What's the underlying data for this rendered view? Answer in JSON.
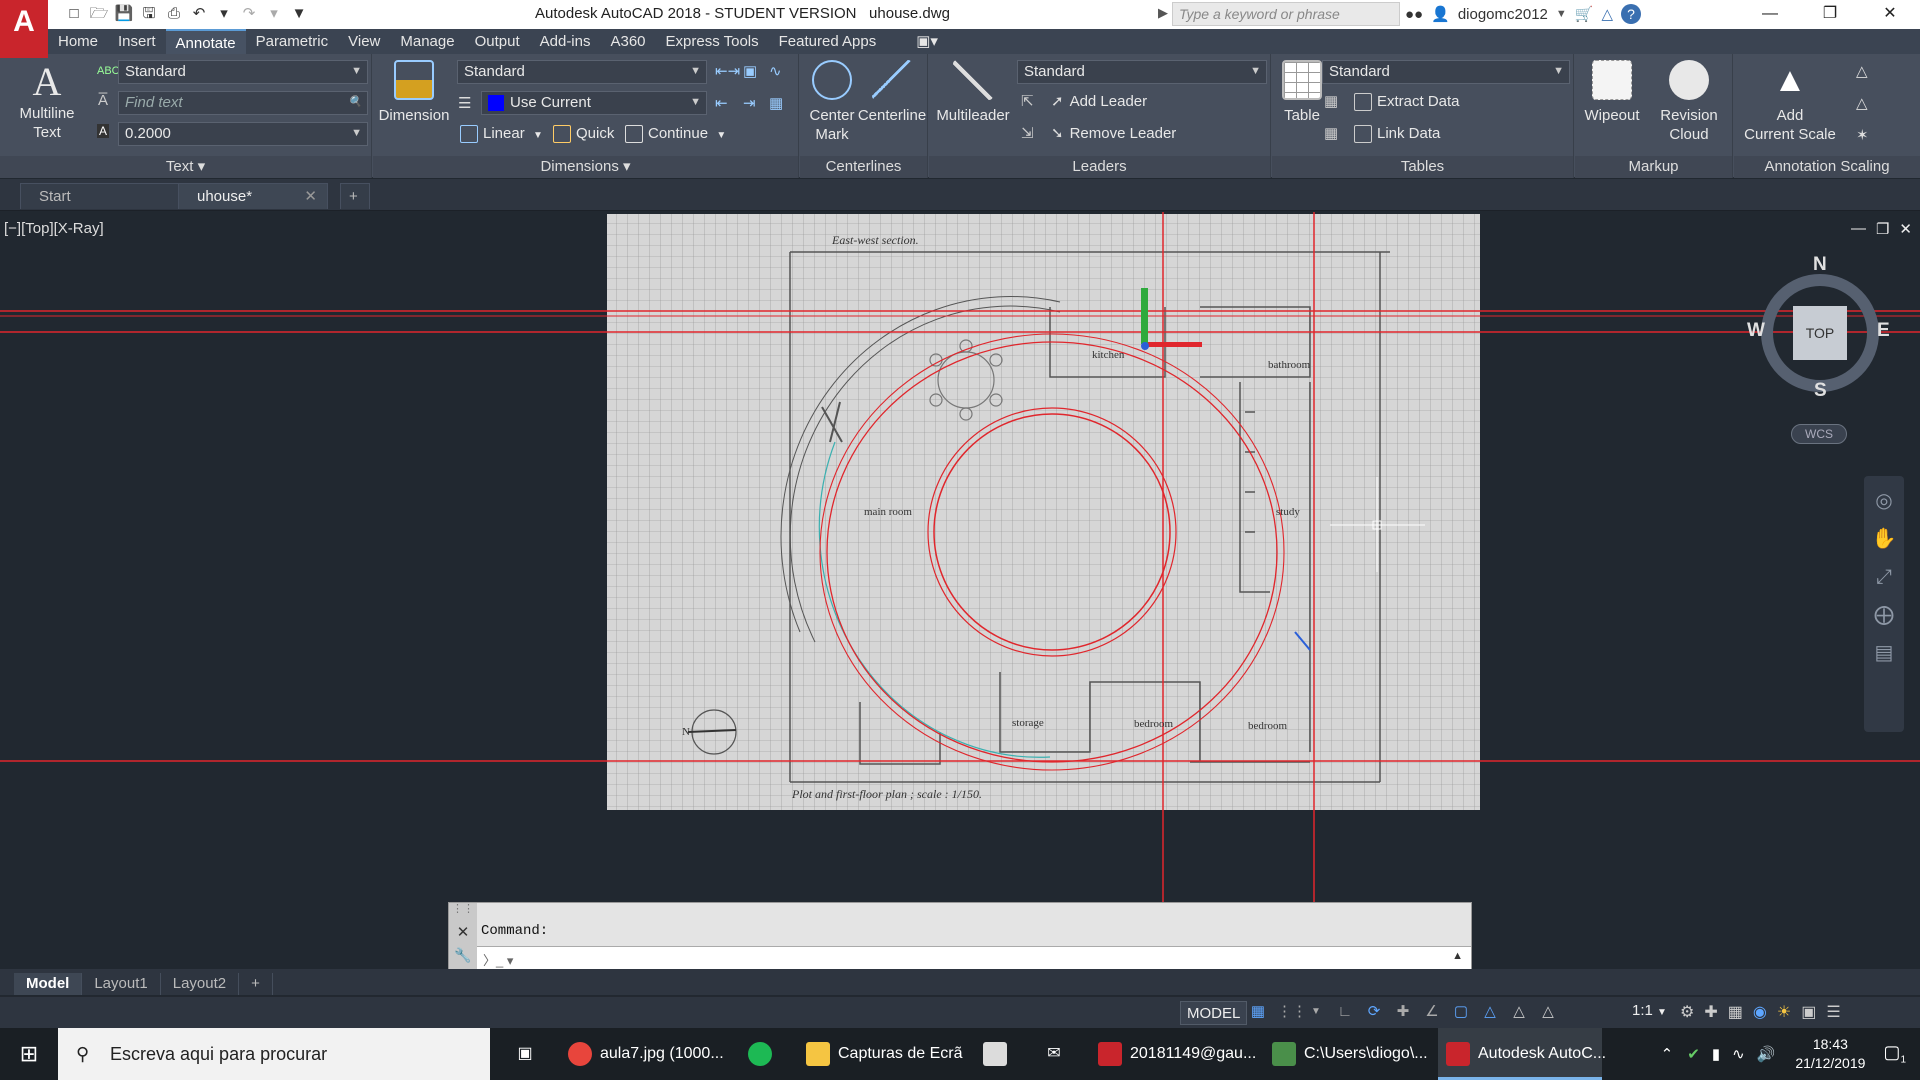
{
  "app": {
    "logo": "A",
    "title": "Autodesk AutoCAD 2018 - STUDENT VERSION",
    "filename": "uhouse.dwg",
    "search_placeholder": "Type a keyword or phrase",
    "user": "diogomc2012"
  },
  "menu_tabs": [
    "Home",
    "Insert",
    "Annotate",
    "Parametric",
    "View",
    "Manage",
    "Output",
    "Add-ins",
    "A360",
    "Express Tools",
    "Featured Apps"
  ],
  "ribbon": {
    "text": {
      "multiline_label_1": "Multiline",
      "multiline_label_2": "Text",
      "style": "Standard",
      "find_placeholder": "Find text",
      "height": "0.2000",
      "title": "Text"
    },
    "dimensions": {
      "button": "Dimension",
      "style": "Standard",
      "layer": "Use Current",
      "linear": "Linear",
      "quick": "Quick",
      "continue": "Continue",
      "title": "Dimensions"
    },
    "centerlines": {
      "center_mark_1": "Center",
      "center_mark_2": "Mark",
      "centerline": "Centerline",
      "title": "Centerlines"
    },
    "leaders": {
      "button": "Multileader",
      "style": "Standard",
      "add": "Add Leader",
      "remove": "Remove Leader",
      "title": "Leaders"
    },
    "tables": {
      "button": "Table",
      "style": "Standard",
      "extract": "Extract Data",
      "link": "Link Data",
      "title": "Tables"
    },
    "markup": {
      "wipeout": "Wipeout",
      "revision_1": "Revision",
      "revision_2": "Cloud",
      "title": "Markup"
    },
    "annotation_scaling": {
      "add_1": "Add",
      "add_2": "Current Scale",
      "title": "Annotation Scaling"
    }
  },
  "doc_tabs": [
    {
      "label": "Start",
      "active": false
    },
    {
      "label": "uhouse*",
      "active": true
    }
  ],
  "viewport": {
    "label": "[−][Top][X-Ray]",
    "compass": {
      "n": "N",
      "s": "S",
      "e": "E",
      "w": "W",
      "face": "TOP"
    },
    "wcs": "WCS",
    "drawing_labels": {
      "section": "East-west section.",
      "kitchen": "kitchen",
      "bathroom": "bathroom",
      "main_room": "main room",
      "study": "study",
      "storage": "storage",
      "bedroom_1": "bedroom",
      "bedroom_2": "bedroom",
      "north": "N",
      "caption": "Plot and first-floor plan ; scale : 1/150."
    }
  },
  "command": {
    "prompt": "Command:"
  },
  "layout_tabs": [
    {
      "label": "Model",
      "active": true
    },
    {
      "label": "Layout1",
      "active": false
    },
    {
      "label": "Layout2",
      "active": false
    }
  ],
  "statusbar": {
    "model": "MODEL",
    "scale": "1:1"
  },
  "taskbar": {
    "search": "Escreva aqui para procurar",
    "apps": [
      {
        "label": "aula7.jpg (1000...",
        "color": "#e8453c"
      },
      {
        "label": "Capturas de Ecrã",
        "color": "#f5c542"
      },
      {
        "label": "20181149@gau...",
        "color": "#c9252c"
      },
      {
        "label": "C:\\Users\\diogo\\...",
        "color": "#4a8f4a"
      },
      {
        "label": "Autodesk AutoC...",
        "color": "#c9252c"
      }
    ],
    "time": "18:43",
    "date": "21/12/2019",
    "notifications": "1"
  }
}
